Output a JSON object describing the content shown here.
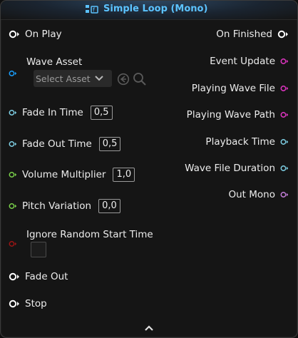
{
  "node": {
    "title": "Simple Loop (Mono)",
    "title_icon": "function-icon",
    "accent": "#5cc3ff"
  },
  "inputs": {
    "on_play": "On Play",
    "wave_asset": "Wave Asset",
    "wave_asset_placeholder": "Select Asset",
    "fade_in_time": {
      "label": "Fade In Time",
      "value": "0,5"
    },
    "fade_out_time": {
      "label": "Fade Out Time",
      "value": "0,5"
    },
    "volume_multiplier": {
      "label": "Volume Multiplier",
      "value": "1,0"
    },
    "pitch_variation": {
      "label": "Pitch Variation",
      "value": "0,0"
    },
    "ignore_random_start_time": "Ignore Random Start Time",
    "fade_out": "Fade Out",
    "stop": "Stop"
  },
  "outputs": {
    "on_finished": "On Finished",
    "event_update": "Event Update",
    "playing_wave_file": "Playing Wave File",
    "playing_wave_path": "Playing Wave Path",
    "playback_time": "Playback Time",
    "wave_file_duration": "Wave File Duration",
    "out_mono": "Out Mono"
  },
  "pin_colors": {
    "exec": "#ffffff",
    "asset": "#1aa0ff",
    "float": "#7fd1e6",
    "float_green": "#7ad14a",
    "bool": "#9b1515",
    "trigger": "#e235c4",
    "audio": "#c57fdb"
  }
}
